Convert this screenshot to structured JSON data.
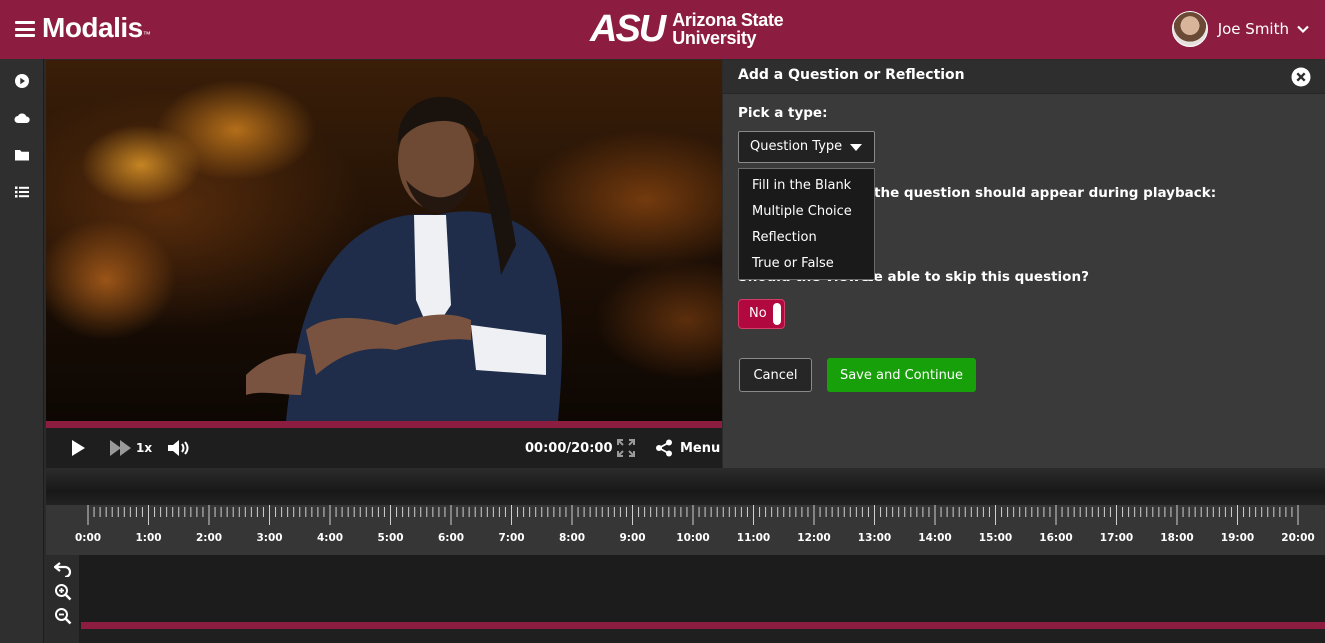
{
  "app": {
    "name": "Modalis",
    "trademark": "™"
  },
  "institution": {
    "mark": "ASU",
    "line1": "Arizona State",
    "line2": "University"
  },
  "user": {
    "name": "Joe Smith"
  },
  "rail": {
    "icons": [
      "play-circle-icon",
      "cloud-icon",
      "folder-icon",
      "list-icon"
    ]
  },
  "player": {
    "time": "00:00/20:00",
    "speed": "1x",
    "menu_label": "Menu",
    "progress": 0
  },
  "panel": {
    "title": "Add a Question or Reflection",
    "pick_type_label": "Pick a type:",
    "select_value": "Question Type",
    "options": [
      "Fill in the Blank",
      "Multiple Choice",
      "Reflection",
      "True or False"
    ],
    "appear_label_partial": "the question should appear during playback:",
    "skip_label_start": "Should the viewer",
    "skip_label_end": "be able to skip this question?",
    "skip_toggle": "No",
    "cancel_label": "Cancel",
    "save_label": "Save and Continue"
  },
  "timeline": {
    "ticks": [
      "0:00",
      "1:00",
      "2:00",
      "3:00",
      "4:00",
      "5:00",
      "6:00",
      "7:00",
      "8:00",
      "9:00",
      "10:00",
      "11:00",
      "12:00",
      "13:00",
      "14:00",
      "15:00",
      "16:00",
      "17:00",
      "18:00",
      "19:00",
      "20:00"
    ]
  },
  "colors": {
    "brand": "#8c1d40",
    "save": "#18a00a",
    "toggle": "#b0083f"
  }
}
